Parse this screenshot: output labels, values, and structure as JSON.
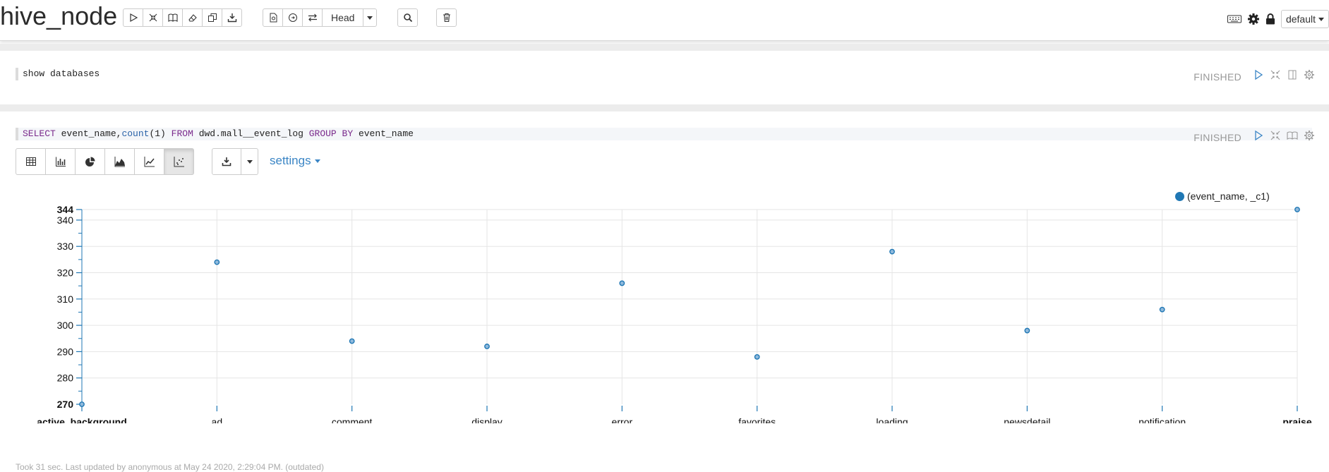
{
  "note": {
    "title": "hive_node",
    "head_label": "Head",
    "interpreter_set": "default"
  },
  "paragraphs": [
    {
      "code": "show databases",
      "status": "FINISHED"
    },
    {
      "code_tokens": [
        {
          "t": "SELECT",
          "c": "kw"
        },
        {
          "t": " event_name,",
          "c": ""
        },
        {
          "t": "count",
          "c": "fn"
        },
        {
          "t": "(1) ",
          "c": ""
        },
        {
          "t": "FROM",
          "c": "kw"
        },
        {
          "t": " dwd.mall__event_log ",
          "c": ""
        },
        {
          "t": "GROUP BY",
          "c": "kw"
        },
        {
          "t": " event_name",
          "c": ""
        }
      ],
      "status": "FINISHED",
      "settings_label": "settings",
      "footer": "Took 31 sec. Last updated by anonymous at May 24 2020, 2:29:04 PM. (outdated)"
    }
  ],
  "icons": {
    "toolbar": [
      "run-all-icon",
      "collapse-icon",
      "book-icon",
      "eraser-icon",
      "clone-icon",
      "export-icon"
    ],
    "version": [
      "version-commit-icon",
      "revision-icon",
      "compare-icon"
    ],
    "right": [
      "keyboard-icon",
      "gear-icon",
      "lock-icon"
    ],
    "viz": [
      "table-icon",
      "bar-chart-icon",
      "pie-chart-icon",
      "area-chart-icon",
      "line-chart-icon",
      "scatter-chart-icon"
    ]
  },
  "colors": {
    "series": "#1f77b4",
    "link": "#3a85c5"
  },
  "chart_data": {
    "type": "scatter",
    "series": [
      {
        "name": "(event_name, _c1)",
        "x": [
          "active_background",
          "ad",
          "comment",
          "display",
          "error",
          "favorites",
          "loading",
          "newsdetail",
          "notification",
          "praise"
        ],
        "y": [
          270,
          324,
          294,
          292,
          316,
          288,
          328,
          298,
          306,
          344
        ]
      }
    ],
    "ylim": [
      270,
      344
    ],
    "yticks": [
      270,
      280,
      290,
      300,
      310,
      320,
      330,
      340,
      344
    ],
    "bold_ticks": [
      "active_background",
      "praise",
      270,
      344
    ],
    "legend_position": "top-right",
    "grid": true
  }
}
